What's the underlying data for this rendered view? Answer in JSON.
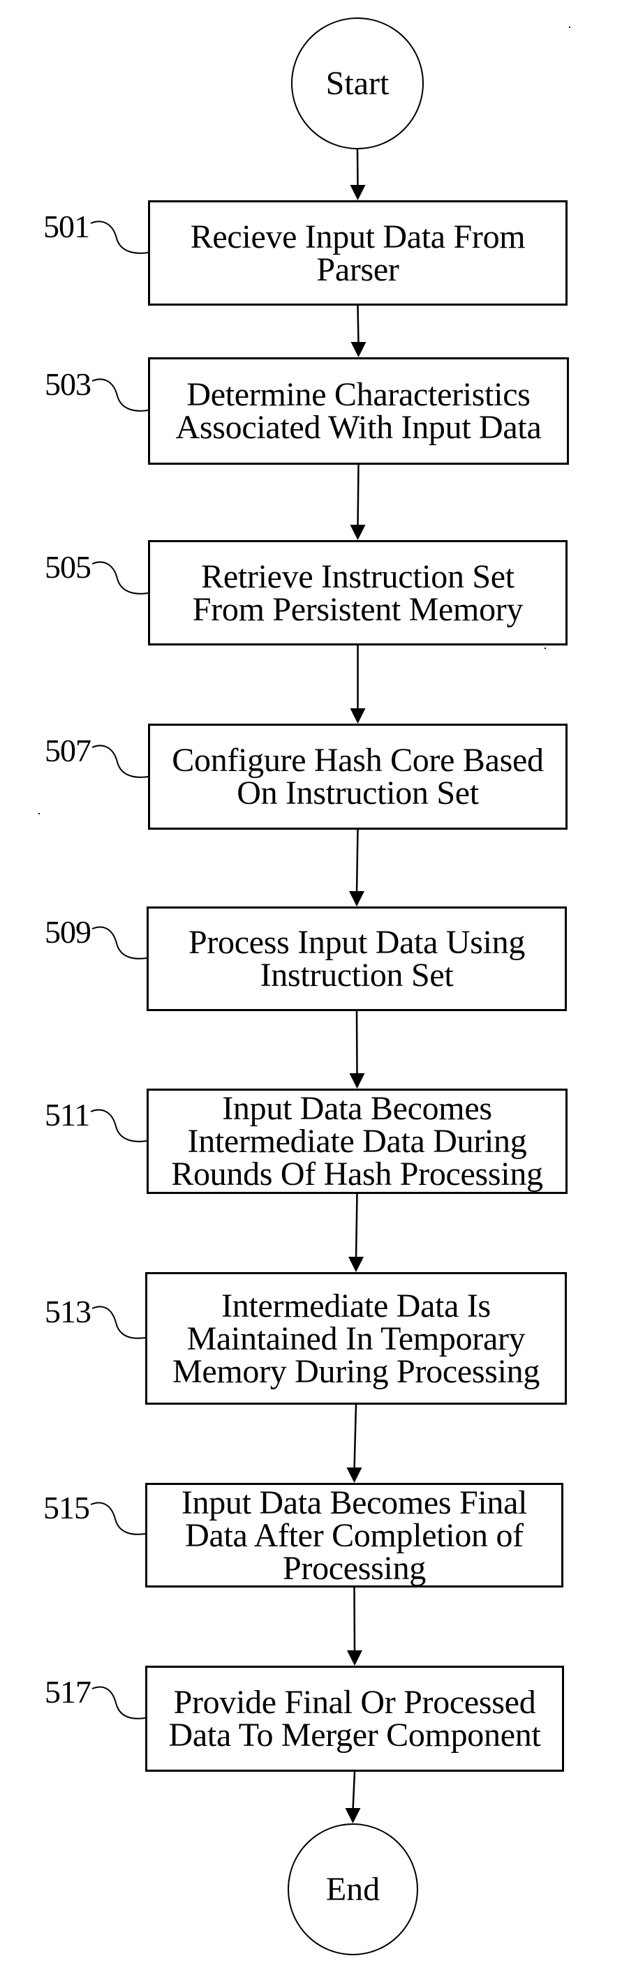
{
  "diagram": {
    "type": "flowchart",
    "direction": "top-to-bottom",
    "start": {
      "label": "Start"
    },
    "end": {
      "label": "End"
    },
    "steps": [
      {
        "ref": "501",
        "text": "Recieve Input Data From\nParser"
      },
      {
        "ref": "503",
        "text": "Determine Characteristics\nAssociated With Input Data"
      },
      {
        "ref": "505",
        "text": "Retrieve Instruction Set\nFrom Persistent Memory"
      },
      {
        "ref": "507",
        "text": "Configure Hash Core Based\nOn Instruction Set"
      },
      {
        "ref": "509",
        "text": "Process Input Data Using\nInstruction Set"
      },
      {
        "ref": "511",
        "text": "Input Data Becomes\nIntermediate Data During\nRounds Of Hash Processing"
      },
      {
        "ref": "513",
        "text": "Intermediate Data Is\nMaintained In Temporary\nMemory During Processing"
      },
      {
        "ref": "515",
        "text": "Input Data Becomes Final\nData After Completion of\nProcessing"
      },
      {
        "ref": "517",
        "text": "Provide Final Or Processed\nData To Merger Component"
      }
    ],
    "edges": [
      [
        "Start",
        "501"
      ],
      [
        "501",
        "503"
      ],
      [
        "503",
        "505"
      ],
      [
        "505",
        "507"
      ],
      [
        "507",
        "509"
      ],
      [
        "509",
        "511"
      ],
      [
        "511",
        "513"
      ],
      [
        "513",
        "515"
      ],
      [
        "515",
        "517"
      ],
      [
        "517",
        "End"
      ]
    ],
    "colors": {
      "ink": "#000000",
      "background": "#ffffff"
    }
  }
}
